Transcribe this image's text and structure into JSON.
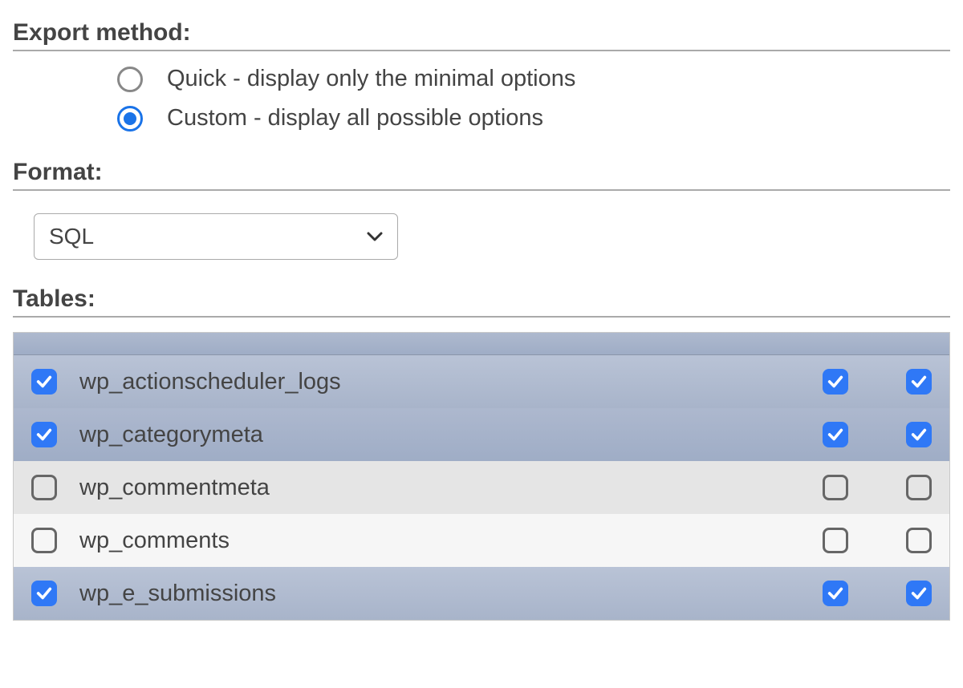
{
  "export_method": {
    "title": "Export method:",
    "options": [
      {
        "label": "Quick - display only the minimal options",
        "checked": false
      },
      {
        "label": "Custom - display all possible options",
        "checked": true
      }
    ]
  },
  "format": {
    "title": "Format:",
    "selected": "SQL"
  },
  "tables": {
    "title": "Tables:",
    "rows": [
      {
        "name": "wp_actionscheduler_logs",
        "selected": true,
        "structure": true,
        "data": true
      },
      {
        "name": "wp_categorymeta",
        "selected": true,
        "structure": true,
        "data": true
      },
      {
        "name": "wp_commentmeta",
        "selected": false,
        "structure": false,
        "data": false
      },
      {
        "name": "wp_comments",
        "selected": false,
        "structure": false,
        "data": false
      },
      {
        "name": "wp_e_submissions",
        "selected": true,
        "structure": true,
        "data": true
      }
    ]
  }
}
